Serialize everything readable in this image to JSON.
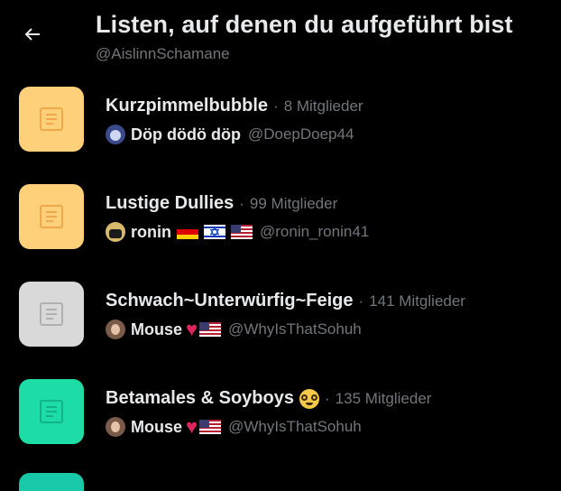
{
  "header": {
    "title": "Listen, auf denen du aufgeführt bist",
    "subtitle": "@AislinnSchamane"
  },
  "lists": [
    {
      "name": "Kurzpimmelbubble",
      "separator": "·",
      "members": "8 Mitglieder",
      "tile_color": "#ffd07a",
      "icon_color": "#f0a94a",
      "owner": {
        "name": "Döp dödö döp",
        "handle": "@DoepDoep44",
        "extras": []
      }
    },
    {
      "name": "Lustige Dullies",
      "separator": "·",
      "members": "99 Mitglieder",
      "tile_color": "#ffd07a",
      "icon_color": "#f0a94a",
      "owner": {
        "name": "ronin",
        "handle": "@ronin_ronin41",
        "extras": [
          "flag-germany-icon",
          "flag-israel-icon",
          "flag-usa-icon"
        ]
      }
    },
    {
      "name": "Schwach~Unterwürfig~Feige",
      "separator": "·",
      "members": "141 Mitglieder",
      "tile_color": "#d9d9d9",
      "icon_color": "#b0b0b0",
      "owner": {
        "name": "Mouse",
        "handle": "@WhyIsThatSohuh",
        "extras": [
          "heart-icon",
          "flag-usa-icon"
        ]
      }
    },
    {
      "name": "Betamales & Soyboys",
      "separator": "·",
      "members": "135 Mitglieder",
      "tile_color": "#1ddca6",
      "icon_color": "#12b487",
      "owner": {
        "name": "Mouse",
        "handle": "@WhyIsThatSohuh",
        "extras": [
          "heart-icon",
          "flag-usa-icon"
        ]
      }
    }
  ],
  "icons": {
    "back": "arrow-left-icon",
    "list_tile": "list-document-icon",
    "title_emoji": "nerd-face-emoji-icon"
  },
  "colors": {
    "background": "#000000",
    "text": "#e7e9ea",
    "muted": "#71767b",
    "heart": "#e0245e"
  }
}
